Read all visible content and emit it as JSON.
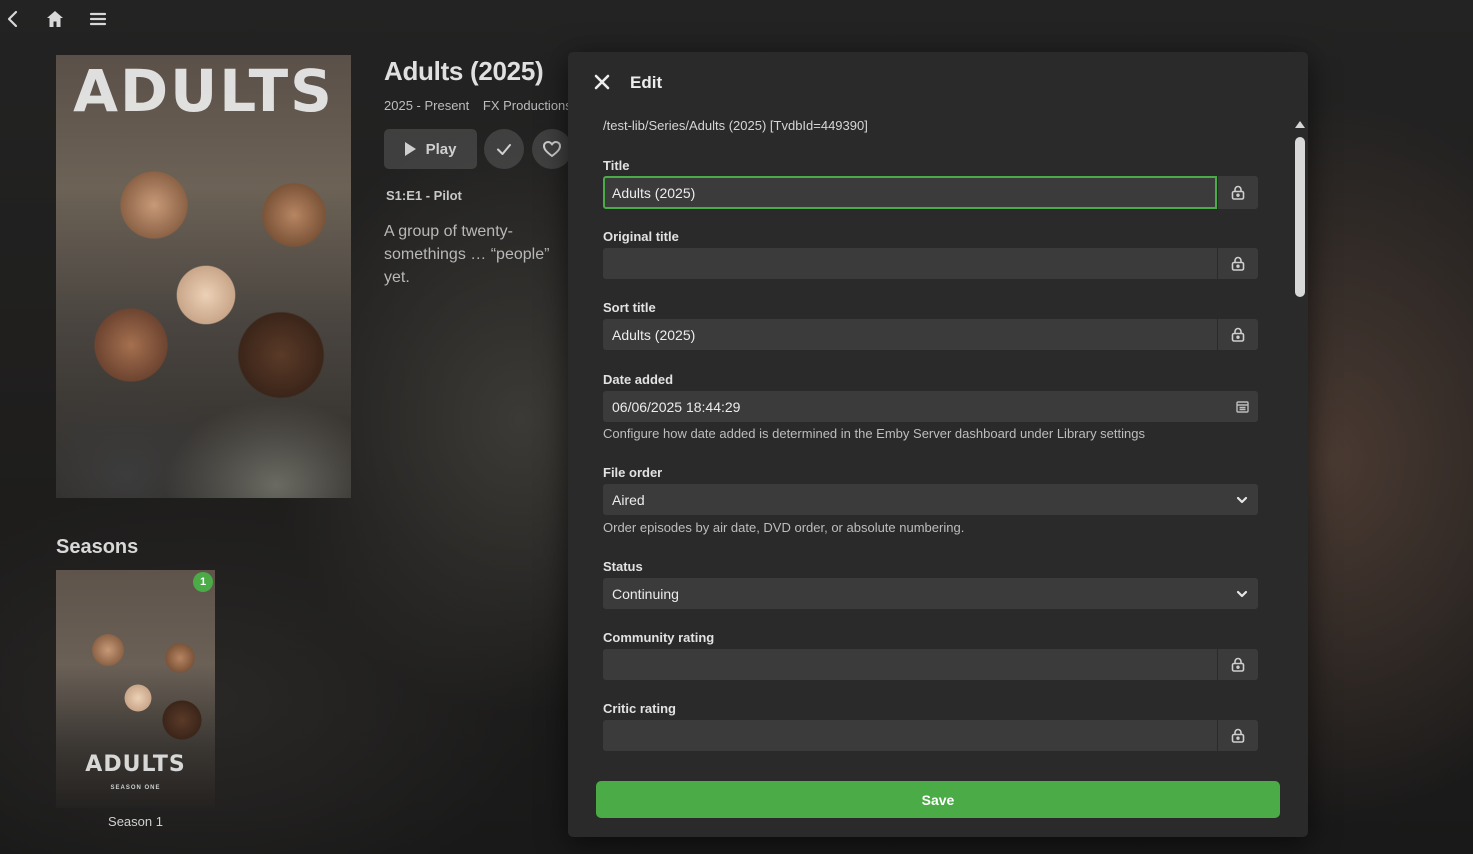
{
  "nav": {
    "back_icon": "chevron-left-icon",
    "home_icon": "home-icon",
    "menu_icon": "hamburger-menu-icon"
  },
  "series": {
    "poster_text": "ADULTS",
    "title": "Adults (2025)",
    "years": "2025 - Present",
    "studio": "FX Productions",
    "play_label": "Play",
    "next_episode": "S1:E1 - Pilot",
    "overview": "A group of twenty-somethings … “people” yet."
  },
  "seasons": {
    "heading": "Seasons",
    "items": [
      {
        "label": "Season 1",
        "badge": "1",
        "art_title": "ADULTS",
        "art_subtitle": "SEASON ONE"
      }
    ]
  },
  "dialog": {
    "title": "Edit",
    "path": "/test-lib/Series/Adults (2025) [TvdbId=449390]",
    "fields": {
      "title": {
        "label": "Title",
        "value": "Adults (2025)"
      },
      "original_title": {
        "label": "Original title",
        "value": ""
      },
      "sort_title": {
        "label": "Sort title",
        "value": "Adults (2025)"
      },
      "date_added": {
        "label": "Date added",
        "value": "06/06/2025 18:44:29",
        "help": "Configure how date added is determined in the Emby Server dashboard under Library settings"
      },
      "file_order": {
        "label": "File order",
        "value": "Aired",
        "help": "Order episodes by air date, DVD order, or absolute numbering."
      },
      "status": {
        "label": "Status",
        "value": "Continuing"
      },
      "community_rating": {
        "label": "Community rating",
        "value": ""
      },
      "critic_rating": {
        "label": "Critic rating",
        "value": ""
      }
    },
    "save_label": "Save"
  },
  "colors": {
    "accent": "#4aab47",
    "dialog_bg": "#2a2a2a",
    "field_bg": "#3b3b3b"
  }
}
